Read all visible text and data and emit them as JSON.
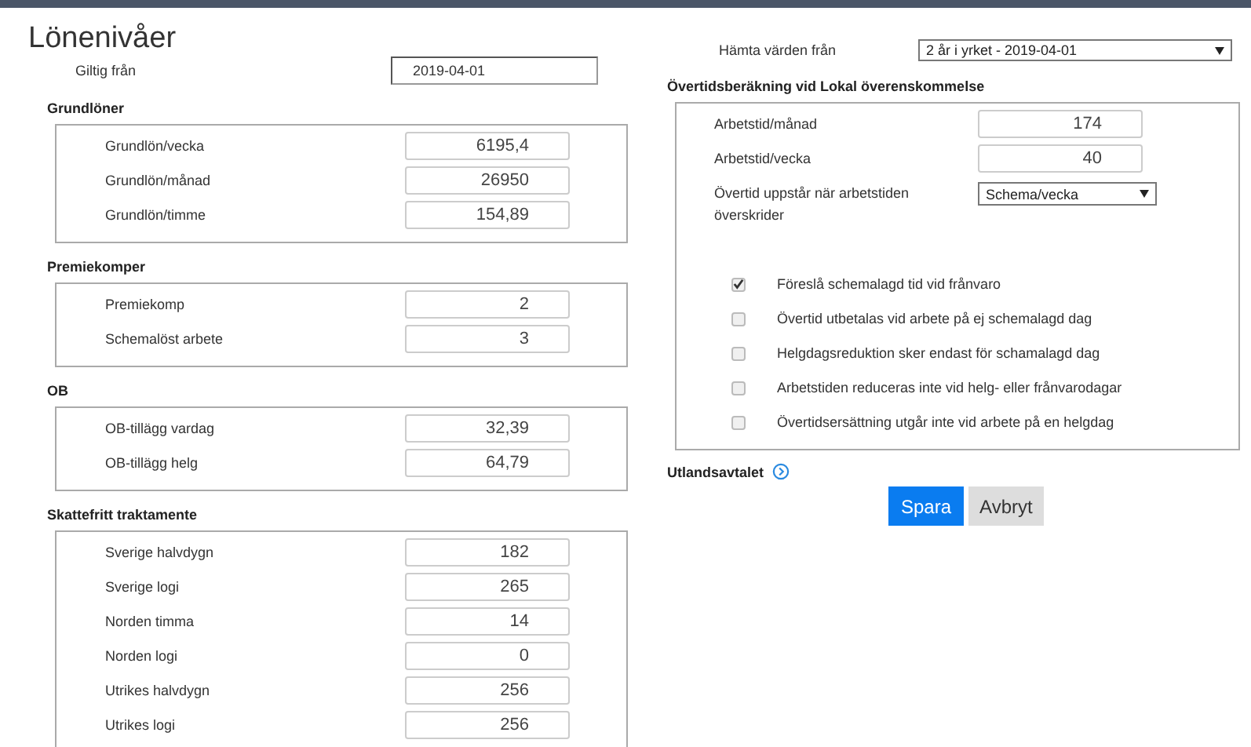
{
  "title": "Lönenivåer",
  "valid_from": {
    "label": "Giltig från",
    "value": "2019-04-01"
  },
  "sections": [
    {
      "heading": "Grundlöner",
      "rows": [
        {
          "label": "Grundlön/vecka",
          "value": "6195,4"
        },
        {
          "label": "Grundlön/månad",
          "value": "26950"
        },
        {
          "label": "Grundlön/timme",
          "value": "154,89"
        }
      ]
    },
    {
      "heading": "Premiekomper",
      "rows": [
        {
          "label": "Premiekomp",
          "value": "2"
        },
        {
          "label": "Schemalöst arbete",
          "value": "3"
        }
      ]
    },
    {
      "heading": "OB",
      "rows": [
        {
          "label": "OB-tillägg vardag",
          "value": "32,39"
        },
        {
          "label": "OB-tillägg helg",
          "value": "64,79"
        }
      ]
    },
    {
      "heading": "Skattefritt traktamente",
      "rows": [
        {
          "label": "Sverige halvdygn",
          "value": "182"
        },
        {
          "label": "Sverige logi",
          "value": "265"
        },
        {
          "label": "Norden timma",
          "value": "14"
        },
        {
          "label": "Norden logi",
          "value": "0"
        },
        {
          "label": "Utrikes halvdygn",
          "value": "256"
        },
        {
          "label": "Utrikes logi",
          "value": "256"
        }
      ]
    }
  ],
  "fetch_from": {
    "label": "Hämta värden från",
    "value": "2 år i yrket - 2019-04-01"
  },
  "overtime": {
    "heading": "Övertidsberäkning vid Lokal överenskommelse",
    "rows": [
      {
        "label": "Arbetstid/månad",
        "value": "174"
      },
      {
        "label": "Arbetstid/vecka",
        "value": "40"
      }
    ],
    "threshold": {
      "label": "Övertid uppstår när arbetstiden överskrider",
      "value": "Schema/vecka"
    },
    "options": [
      {
        "label": "Föreslå schemalagd tid vid frånvaro",
        "checked": true
      },
      {
        "label": "Övertid utbetalas vid arbete på ej schemalagd dag",
        "checked": false
      },
      {
        "label": "Helgdagsreduktion sker endast för schamalagd dag",
        "checked": false
      },
      {
        "label": "Arbetstiden reduceras inte vid helg- eller frånvarodagar",
        "checked": false
      },
      {
        "label": "Övertidsersättning utgår inte vid arbete på en helgdag",
        "checked": false
      }
    ]
  },
  "foreign": {
    "label": "Utlandsavtalet"
  },
  "buttons": [
    {
      "label": "Spara",
      "kind": "primary"
    },
    {
      "label": "Avbryt",
      "kind": "secondary"
    }
  ]
}
